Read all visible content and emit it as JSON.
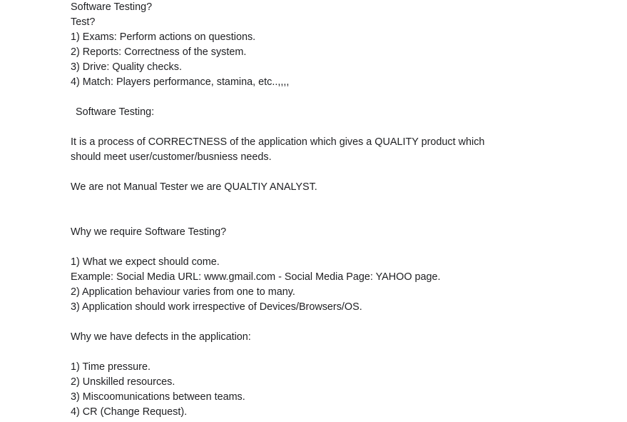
{
  "doc": {
    "intro": {
      "title": "Software Testing?",
      "question": "Test?",
      "examples": [
        "1) Exams: Perform actions on questions.",
        "2) Reports: Correctness of the system.",
        "3) Drive: Quality checks.",
        "4) Match: Players performance, stamina, etc..,,,,"
      ]
    },
    "definition": {
      "heading": "Software Testing:",
      "text": "It is a process of CORRECTNESS of the application which gives a QUALITY product which should meet user/customer/busniess needs.",
      "note": "We are not Manual Tester we are QUALTIY ANALYST."
    },
    "why_testing": {
      "heading": "Why we require Software Testing?",
      "items": [
        "1) What we expect should come.",
        "Example: Social Media URL: www.gmail.com - Social Media Page: YAHOO page.",
        "2) Application behaviour varies from one to many.",
        "3) Application should work irrespective of Devices/Browsers/OS."
      ]
    },
    "why_defects": {
      "heading": "Why we have defects in the application:",
      "items": [
        "1) Time pressure.",
        "2) Unskilled resources.",
        "3) Miscoomunications between teams.",
        "4) CR (Change Request)."
      ]
    }
  }
}
